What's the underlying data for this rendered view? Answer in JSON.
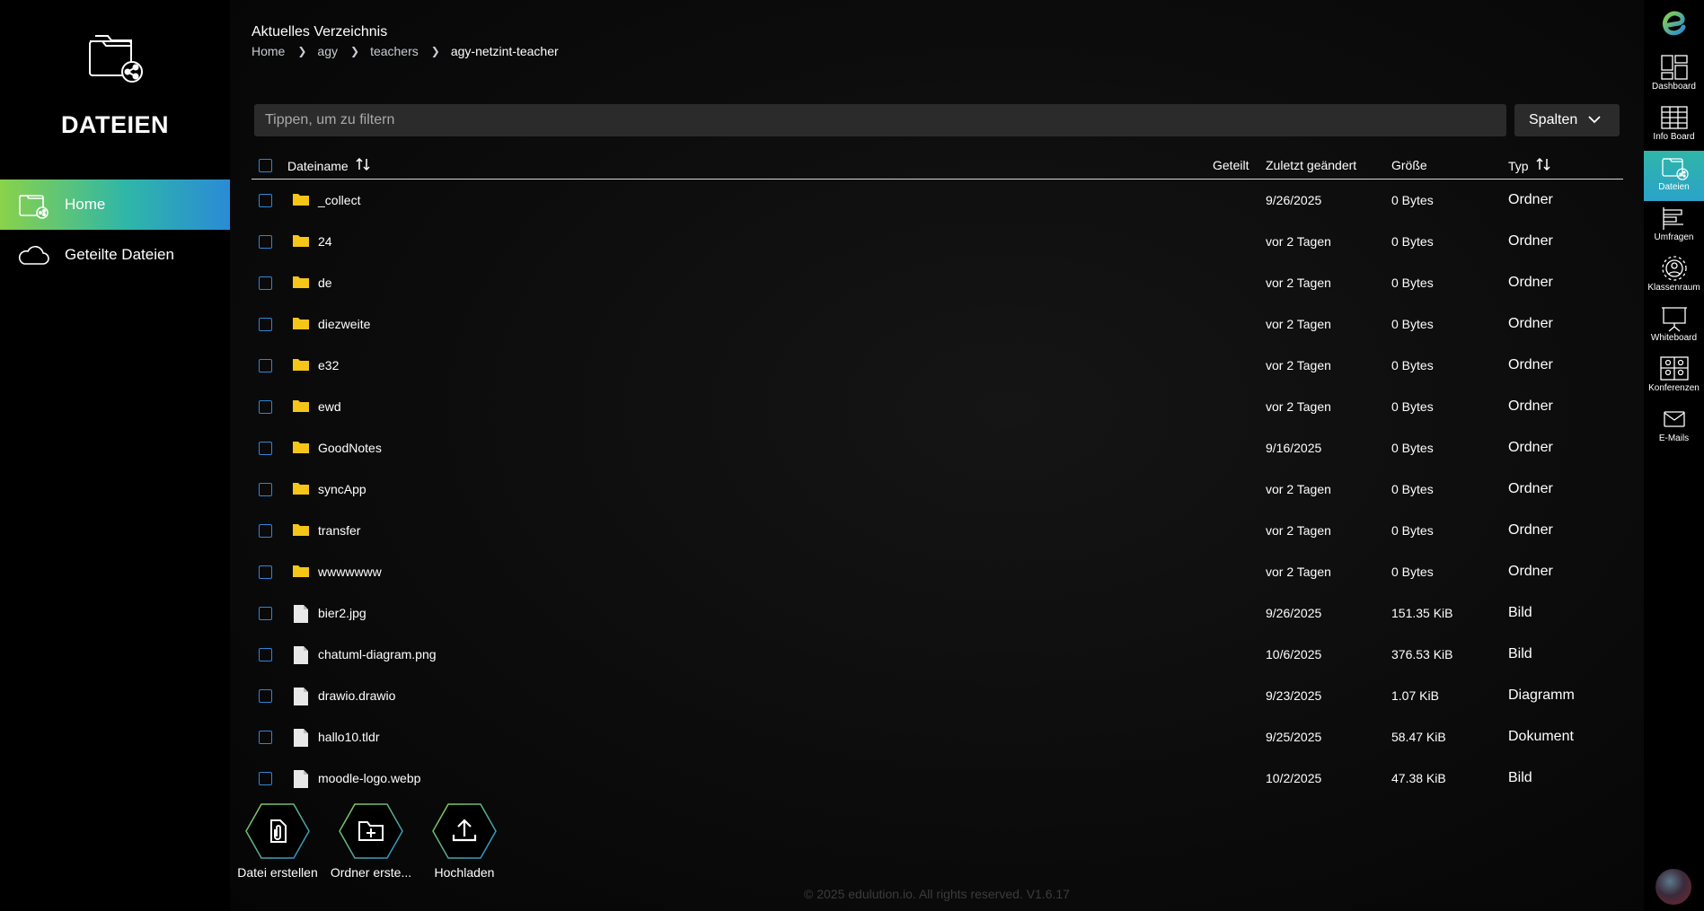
{
  "app": {
    "title": "DATEIEN"
  },
  "sidebar": {
    "items": [
      {
        "label": "Home",
        "icon": "folder-share-icon",
        "active": true
      },
      {
        "label": "Geteilte Dateien",
        "icon": "cloud-icon",
        "active": false
      }
    ]
  },
  "header": {
    "current_dir_label": "Aktuelles Verzeichnis",
    "breadcrumb": [
      "Home",
      "agy",
      "teachers",
      "agy-netzint-teacher"
    ]
  },
  "filter": {
    "placeholder": "Tippen, um zu filtern",
    "value": ""
  },
  "columns_button": {
    "label": "Spalten"
  },
  "table": {
    "headers": {
      "name": "Dateiname",
      "shared": "Geteilt",
      "modified": "Zuletzt geändert",
      "size": "Größe",
      "type": "Typ"
    },
    "rows": [
      {
        "name": "_collect",
        "modified": "9/26/2025",
        "size": "0 Bytes",
        "type": "Ordner",
        "icon": "folder-icon"
      },
      {
        "name": "24",
        "modified": "vor 2 Tagen",
        "size": "0 Bytes",
        "type": "Ordner",
        "icon": "folder-icon"
      },
      {
        "name": "de",
        "modified": "vor 2 Tagen",
        "size": "0 Bytes",
        "type": "Ordner",
        "icon": "folder-icon"
      },
      {
        "name": "diezweite",
        "modified": "vor 2 Tagen",
        "size": "0 Bytes",
        "type": "Ordner",
        "icon": "folder-icon"
      },
      {
        "name": "e32",
        "modified": "vor 2 Tagen",
        "size": "0 Bytes",
        "type": "Ordner",
        "icon": "folder-icon"
      },
      {
        "name": "ewd",
        "modified": "vor 2 Tagen",
        "size": "0 Bytes",
        "type": "Ordner",
        "icon": "folder-icon"
      },
      {
        "name": "GoodNotes",
        "modified": "9/16/2025",
        "size": "0 Bytes",
        "type": "Ordner",
        "icon": "folder-icon"
      },
      {
        "name": "syncApp",
        "modified": "vor 2 Tagen",
        "size": "0 Bytes",
        "type": "Ordner",
        "icon": "folder-icon"
      },
      {
        "name": "transfer",
        "modified": "vor 2 Tagen",
        "size": "0 Bytes",
        "type": "Ordner",
        "icon": "folder-icon"
      },
      {
        "name": "wwwwwww",
        "modified": "vor 2 Tagen",
        "size": "0 Bytes",
        "type": "Ordner",
        "icon": "folder-icon"
      },
      {
        "name": "bier2.jpg",
        "modified": "9/26/2025",
        "size": "151.35 KiB",
        "type": "Bild",
        "icon": "file-icon",
        "ext": "jpg"
      },
      {
        "name": "chatuml-diagram.png",
        "modified": "10/6/2025",
        "size": "376.53 KiB",
        "type": "Bild",
        "icon": "file-icon",
        "ext": "png"
      },
      {
        "name": "drawio.drawio",
        "modified": "9/23/2025",
        "size": "1.07 KiB",
        "type": "Diagramm",
        "icon": "file-icon",
        "ext": "drawio"
      },
      {
        "name": "hallo10.tldr",
        "modified": "9/25/2025",
        "size": "58.47 KiB",
        "type": "Dokument",
        "icon": "file-icon",
        "ext": "tldr"
      },
      {
        "name": "moodle-logo.webp",
        "modified": "10/2/2025",
        "size": "47.38 KiB",
        "type": "Bild",
        "icon": "file-icon",
        "ext": "webp"
      }
    ]
  },
  "actions": [
    {
      "label": "Datei erstellen",
      "icon": "paperclip-file-icon"
    },
    {
      "label": "Ordner erste...",
      "icon": "folder-plus-icon"
    },
    {
      "label": "Hochladen",
      "icon": "upload-icon"
    }
  ],
  "footer": {
    "text": "© 2025 edulution.io. All rights reserved. V1.6.17"
  },
  "right_rail": {
    "brand_icon": "edulution-logo",
    "items": [
      {
        "label": "Dashboard",
        "icon": "dashboard-icon",
        "active": false
      },
      {
        "label": "Info Board",
        "icon": "info-board-icon",
        "active": false
      },
      {
        "label": "Dateien",
        "icon": "files-icon",
        "active": true
      },
      {
        "label": "Umfragen",
        "icon": "surveys-icon",
        "active": false
      },
      {
        "label": "Klassenraum",
        "icon": "classroom-icon",
        "active": false
      },
      {
        "label": "Whiteboard",
        "icon": "whiteboard-icon",
        "active": false
      },
      {
        "label": "Konferenzen",
        "icon": "conferences-icon",
        "active": false
      },
      {
        "label": "E-Mails",
        "icon": "mail-icon",
        "active": false
      }
    ]
  },
  "colors": {
    "accent_green": "#8ad24a",
    "accent_teal": "#2fb6a8",
    "accent_blue": "#2a8bd6",
    "folder_yellow": "#f5c518",
    "checkbox_blue": "#2f86d6"
  }
}
